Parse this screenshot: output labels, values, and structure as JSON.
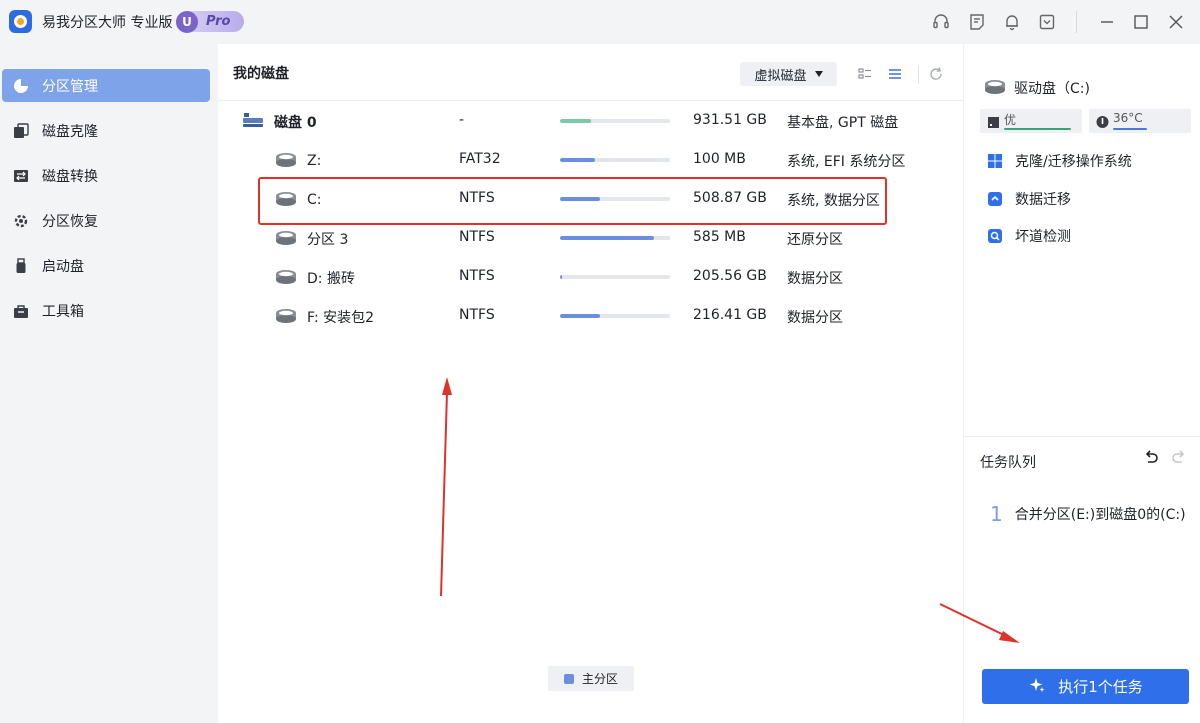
{
  "app": {
    "title": "易我分区大师 专业版",
    "badge_u": "U",
    "badge_text": "Pro"
  },
  "sidebar": {
    "items": [
      {
        "label": "分区管理",
        "icon": "pie-chart-icon",
        "active": true
      },
      {
        "label": "磁盘克隆",
        "icon": "clone-icon",
        "active": false
      },
      {
        "label": "磁盘转换",
        "icon": "convert-icon",
        "active": false
      },
      {
        "label": "分区恢复",
        "icon": "recover-icon",
        "active": false
      },
      {
        "label": "启动盘",
        "icon": "usb-icon",
        "active": false
      },
      {
        "label": "工具箱",
        "icon": "toolbox-icon",
        "active": false
      }
    ]
  },
  "main": {
    "title": "我的磁盘",
    "virtual_disk_label": "虚拟磁盘",
    "disk": {
      "name": "磁盘 0",
      "fs": "-",
      "size": "931.51 GB",
      "desc": "基本盘, GPT 磁盘",
      "usage": 0.28
    },
    "partitions": [
      {
        "name": "Z:",
        "fs": "FAT32",
        "size": "100 MB",
        "desc": "系统, EFI 系统分区",
        "usage": 0.32
      },
      {
        "name": "C:",
        "fs": "NTFS",
        "size": "508.87 GB",
        "desc": "系统, 数据分区",
        "usage": 0.36
      },
      {
        "name": "分区 3",
        "fs": "NTFS",
        "size": "585 MB",
        "desc": "还原分区",
        "usage": 0.85
      },
      {
        "name": "D: 搬砖",
        "fs": "NTFS",
        "size": "205.56 GB",
        "desc": "数据分区",
        "usage": 0.02
      },
      {
        "name": "F: 安装包2",
        "fs": "NTFS",
        "size": "216.41 GB",
        "desc": "数据分区",
        "usage": 0.36
      }
    ],
    "legend_label": "主分区"
  },
  "right_panel": {
    "drive_title": "驱动盘（C:)",
    "health_label": "优",
    "temp_label": "36°C",
    "actions": [
      "克隆/迁移操作系统",
      "数据迁移",
      "坏道检测"
    ],
    "queue_title": "任务队列",
    "tasks": [
      {
        "index": "1",
        "label": "合并分区(E:)到磁盘0的(C:)"
      }
    ],
    "run_button_label": "执行1个任务"
  },
  "colors": {
    "accent": "#2f6fe9",
    "sidebar_active": "#7fa3e8",
    "disk_bar": "#7cc9a6",
    "partition_bar": "#6b8fde",
    "highlight": "#e0312a"
  }
}
